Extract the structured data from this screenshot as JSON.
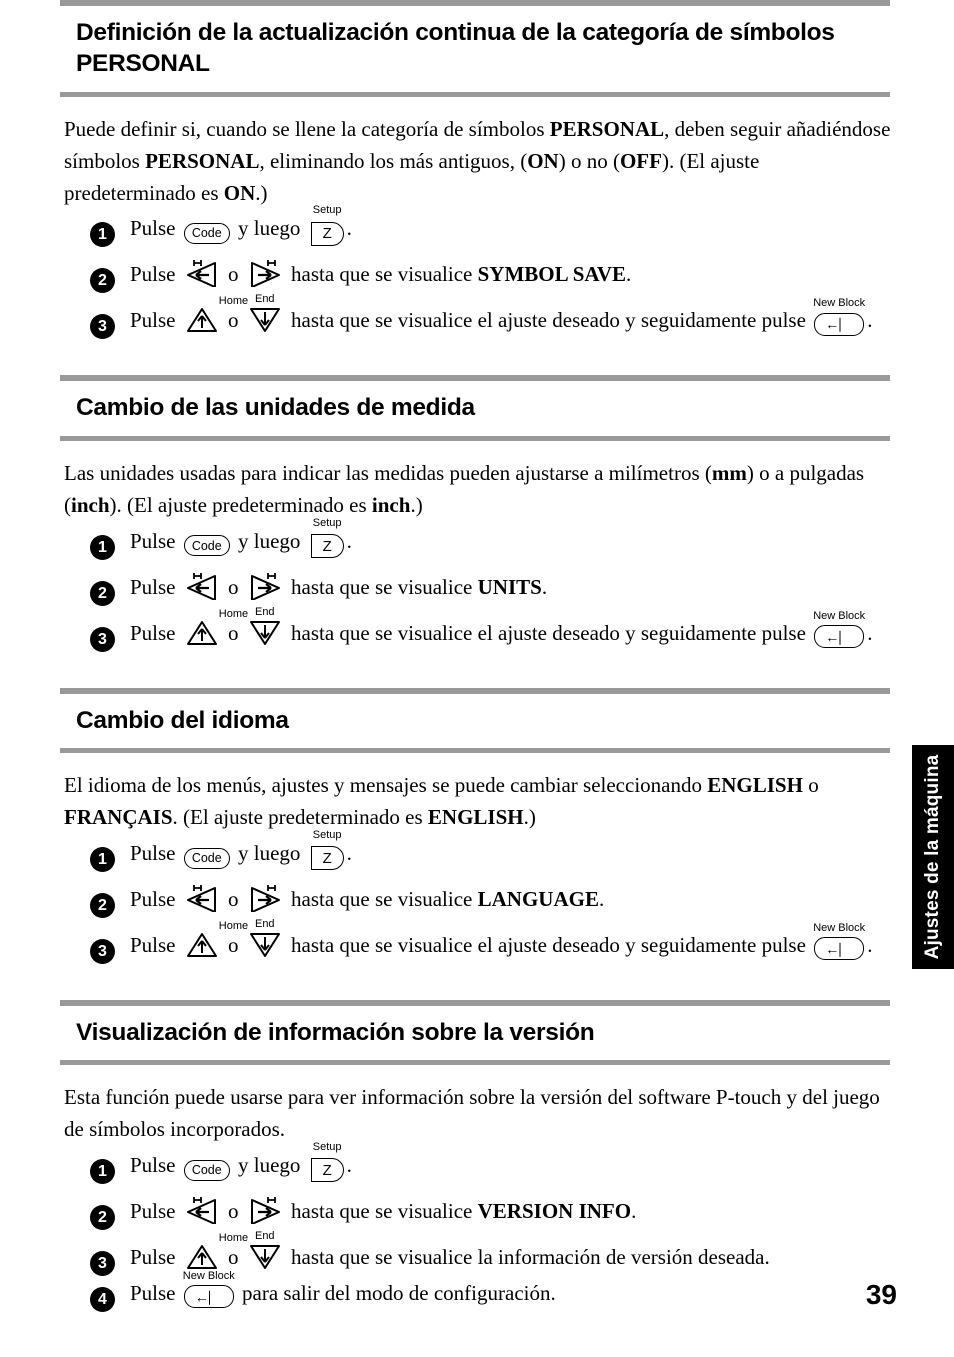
{
  "page": {
    "number": "39",
    "side_tab_label": "Ajustes de la máquina"
  },
  "keys": {
    "code": "Code",
    "setup_label": "Setup",
    "setup_key": "Z",
    "new_block_label": "New Block",
    "home_label": "Home",
    "end_label": "End"
  },
  "sections": [
    {
      "heading": "Definición de la actualización continua de la categoría de símbolos PERSONAL",
      "intro_1": "Puede definir si, cuando se llene la categoría de símbolos ",
      "intro_b1": "PERSONAL",
      "intro_2": ", deben seguir añadiéndose símbolos ",
      "intro_b2": "PERSONAL",
      "intro_3": ", eliminando los más antiguos, (",
      "intro_b3": "ON",
      "intro_4": ") o no (",
      "intro_b4": "OFF",
      "intro_5": "). (El ajuste predeterminado es ",
      "intro_b5": "ON",
      "intro_6": ".)",
      "step1_pre": "Pulse",
      "step1_mid": "y luego",
      "step1_post": ".",
      "step2_pre": "Pulse",
      "step2_mid": "o",
      "step2_post": "hasta que se visualice",
      "step2_target": "SYMBOL SAVE",
      "step2_end": ".",
      "step3_pre": "Pulse",
      "step3_mid": "o",
      "step3_post": "hasta que se visualice el ajuste deseado y seguidamente pulse",
      "step3_end": "."
    },
    {
      "heading": "Cambio de las unidades de medida",
      "intro_1": "Las unidades usadas para indicar las medidas pueden ajustarse a milímetros (",
      "intro_b1": "mm",
      "intro_2": ") o a pulgadas (",
      "intro_b2": "inch",
      "intro_3": "). (El ajuste predeterminado es ",
      "intro_b3": "inch",
      "intro_4": ".)",
      "step1_pre": "Pulse",
      "step1_mid": "y luego",
      "step1_post": ".",
      "step2_pre": "Pulse",
      "step2_mid": "o",
      "step2_post": "hasta que se visualice",
      "step2_target": "UNITS",
      "step2_end": ".",
      "step3_pre": "Pulse",
      "step3_mid": "o",
      "step3_post": "hasta que se visualice el ajuste deseado y seguidamente pulse",
      "step3_end": "."
    },
    {
      "heading": "Cambio del idioma",
      "intro_1": "El idioma de los menús, ajustes y mensajes se puede cambiar seleccionando ",
      "intro_b1": "ENGLISH",
      "intro_2": " o ",
      "intro_b2": "FRANÇAIS",
      "intro_3": ". (El ajuste predeterminado es ",
      "intro_b3": "ENGLISH",
      "intro_4": ".)",
      "step1_pre": "Pulse",
      "step1_mid": "y luego",
      "step1_post": ".",
      "step2_pre": "Pulse",
      "step2_mid": "o",
      "step2_post": "hasta que se visualice",
      "step2_target": "LANGUAGE",
      "step2_end": ".",
      "step3_pre": "Pulse",
      "step3_mid": "o",
      "step3_post": "hasta que se visualice el ajuste deseado y seguidamente pulse",
      "step3_end": "."
    },
    {
      "heading": "Visualización de información sobre la versión",
      "intro_1": "Esta función puede usarse para ver información sobre la versión del software P-touch y del juego de símbolos incorporados.",
      "step1_pre": "Pulse",
      "step1_mid": "y luego",
      "step1_post": ".",
      "step2_pre": "Pulse",
      "step2_mid": "o",
      "step2_post": "hasta que se visualice",
      "step2_target": "VERSION INFO",
      "step2_end": ".",
      "step3_pre": "Pulse",
      "step3_mid": "o",
      "step3_post": "hasta que se visualice la información de versión deseada.",
      "step4_pre": "Pulse",
      "step4_post": "para salir del modo de configuración."
    }
  ]
}
